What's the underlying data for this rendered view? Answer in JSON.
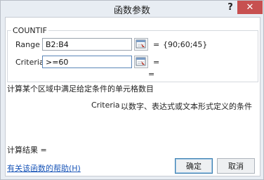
{
  "dialog": {
    "title": "函数参数",
    "help_glyph": "?",
    "close_glyph": "✕"
  },
  "function": {
    "name": "COUNTIF",
    "result_equals": "=",
    "description": "计算某个区域中满足给定条件的单元格数目"
  },
  "arguments": [
    {
      "label": "Range",
      "value": "B2:B4",
      "equals": "=",
      "result": "{90;60;45}"
    },
    {
      "label": "Criteria",
      "value": ">=60",
      "equals": "=",
      "result": ""
    }
  ],
  "argument_help": {
    "name": "Criteria",
    "text": "以数字、表达式或文本形式定义的条件"
  },
  "calc": {
    "label": "计算结果 ="
  },
  "footer": {
    "help_link": "有关该函数的帮助(H)",
    "ok_label": "确定",
    "cancel_label": "取消"
  }
}
